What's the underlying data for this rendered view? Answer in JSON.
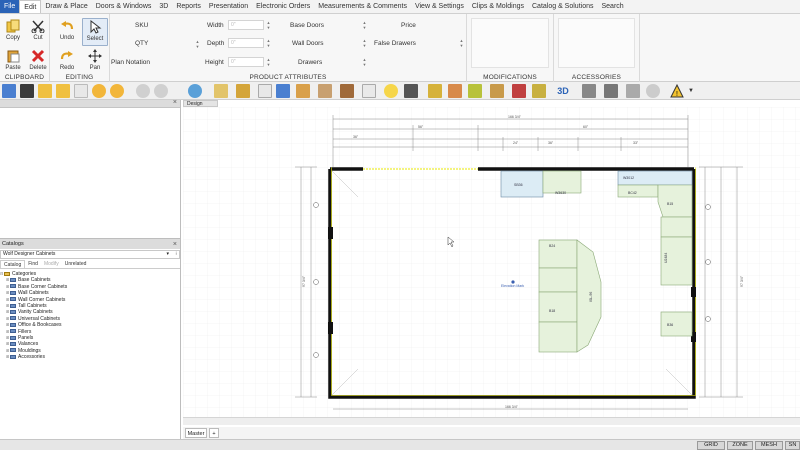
{
  "menu": [
    {
      "label": "File"
    },
    {
      "label": "Edit"
    },
    {
      "label": "Draw & Place"
    },
    {
      "label": "Doors & Windows"
    },
    {
      "label": "3D"
    },
    {
      "label": "Reports"
    },
    {
      "label": "Presentation"
    },
    {
      "label": "Electronic Orders"
    },
    {
      "label": "Measurements & Comments"
    },
    {
      "label": "View & Settings"
    },
    {
      "label": "Clips & Moldings"
    },
    {
      "label": "Catalog & Solutions"
    },
    {
      "label": "Search"
    }
  ],
  "ribbon": {
    "clipboard": {
      "label": "CLIPBOARD",
      "copy": "Copy",
      "paste": "Paste",
      "cut": "Cut",
      "delete": "Delete"
    },
    "editing": {
      "label": "EDITING",
      "undo": "Undo",
      "redo": "Redo",
      "select": "Select",
      "pan": "Pan"
    },
    "product_attributes": {
      "label": "PRODUCT ATTRIBUTES",
      "sku": "SKU",
      "qty": "QTY",
      "plan_notation": "Plan Notation",
      "width": "Width",
      "depth": "Depth",
      "height": "Height",
      "width_val": "0\"",
      "depth_val": "0\"",
      "height_val": "0\"",
      "base_doors": "Base Doors",
      "wall_doors": "Wall Doors",
      "drawers": "Drawers",
      "price": "Price",
      "false_drawers": "False Drawers"
    },
    "modifications": {
      "label": "MODIFICATIONS"
    },
    "accessories": {
      "label": "ACCESSORIES"
    }
  },
  "catalog": {
    "title": "Catalogs",
    "selected": "Wolf Designer Cabinets",
    "tabs": [
      "Catalog",
      "Find",
      "Modify",
      "Unrelated"
    ],
    "root": "Categories",
    "items": [
      "Base Cabinets",
      "Base Corner Cabinets",
      "Wall Cabinets",
      "Wall Corner Cabinets",
      "Tall Cabinets",
      "Vanity Cabinets",
      "Universal Cabinets",
      "Office & Bookcases",
      "Fillers",
      "Panels",
      "Valances",
      "Mouldings",
      "Accessories"
    ]
  },
  "design": {
    "tab": "Design",
    "bottom_tab": "Master",
    "add_tab": "+",
    "dims": {
      "top": "166 3/4\"",
      "bottom": "166 3/4\"",
      "left": "97 3/4\"",
      "right": "97 3/4\"",
      "seg1": "56\"",
      "seg2": "60\"",
      "seg3": "36\"",
      "seg4": "24\"",
      "seg5": "36\"",
      "seg6": "33\""
    },
    "labels": {
      "sink_base": "SB36",
      "wall_top": "W3630",
      "wall_top2": "W3012",
      "corner": "BC42",
      "island": "ISL-96",
      "island2": "B24",
      "island3": "B18",
      "tall": "U2484",
      "base_r": "B15",
      "base_r2": "B36",
      "center_note": "Elevation Mark"
    }
  },
  "status": [
    "GRID",
    "ZONE",
    "MESH",
    "SN"
  ],
  "colors": {
    "accent": "#2b63b7",
    "cabinet": "#e6f2dc",
    "cabinet_line": "#8aa876",
    "wall": "#111111",
    "wall_highlight": "#e8e800"
  }
}
